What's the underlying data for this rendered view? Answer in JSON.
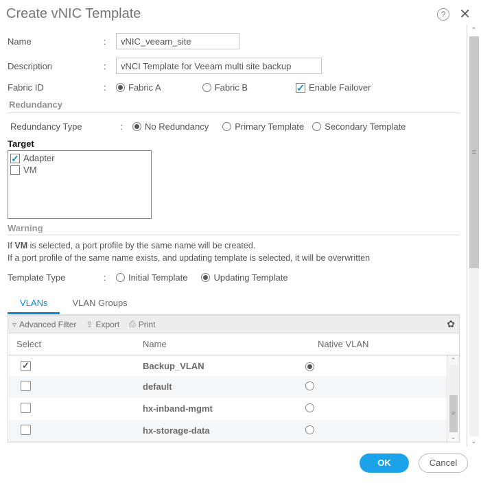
{
  "dialog": {
    "title": "Create vNIC Template"
  },
  "form": {
    "name_label": "Name",
    "name_value": "vNIC_veeam_site",
    "desc_label": "Description",
    "desc_value": "vNCI Template for Veeam multi site backup",
    "fabric_label": "Fabric ID",
    "fabric_a": "Fabric A",
    "fabric_b": "Fabric B",
    "fabric_selected": "A",
    "enable_failover_label": "Enable Failover",
    "enable_failover_checked": true,
    "redundancy_head": "Redundancy",
    "redtype_label": "Redundancy Type",
    "redtype_options": {
      "none": "No Redundancy",
      "primary": "Primary Template",
      "secondary": "Secondary Template"
    },
    "redtype_selected": "none",
    "target_head": "Target",
    "target_adapter_label": "Adapter",
    "target_adapter_checked": true,
    "target_vm_label": "VM",
    "target_vm_checked": false,
    "warning_head": "Warning",
    "warning_line1_a": "If ",
    "warning_line1_b": "VM",
    "warning_line1_c": " is selected, a port profile by the same name will be created.",
    "warning_line2": "If a port profile of the same name exists, and updating template is selected, it will be overwritten",
    "tmpltype_label": "Template Type",
    "tmpltype_options": {
      "initial": "Initial Template",
      "updating": "Updating Template"
    },
    "tmpltype_selected": "updating"
  },
  "tabs": {
    "vlans": "VLANs",
    "vlangroups": "VLAN Groups",
    "active": "vlans"
  },
  "toolbar": {
    "filter": "Advanced Filter",
    "export": "Export",
    "print": "Print"
  },
  "grid": {
    "headers": {
      "select": "Select",
      "name": "Name",
      "native": "Native VLAN"
    },
    "rows": [
      {
        "selected": true,
        "name": "Backup_VLAN",
        "native": true
      },
      {
        "selected": false,
        "name": "default",
        "native": false
      },
      {
        "selected": false,
        "name": "hx-inband-mgmt",
        "native": false
      },
      {
        "selected": false,
        "name": "hx-storage-data",
        "native": false
      }
    ]
  },
  "footer": {
    "ok": "OK",
    "cancel": "Cancel"
  }
}
